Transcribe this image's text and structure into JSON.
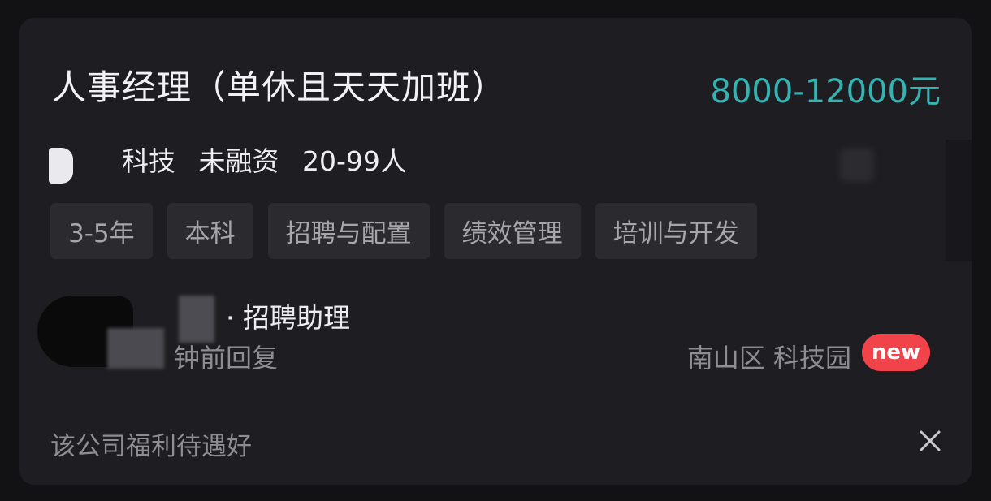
{
  "job": {
    "title": "人事经理（单休且天天加班）",
    "salary": "8000-12000元"
  },
  "company": {
    "name_visible": "科技",
    "funding": "未融资",
    "size": "20-99人"
  },
  "tags": [
    "3-5年",
    "本科",
    "招聘与配置",
    "绩效管理",
    "培训与开发"
  ],
  "recruiter": {
    "role": "· 招聘助理",
    "reply_status": "钟前回复"
  },
  "location": "南山区 科技园",
  "badge": "new",
  "benefit_note": "该公司福利待遇好",
  "colors": {
    "salary": "#33b3b1",
    "badge_bg": "#f0444a",
    "card_bg": "#1e1e22"
  },
  "icons": {
    "close": "close-icon"
  }
}
